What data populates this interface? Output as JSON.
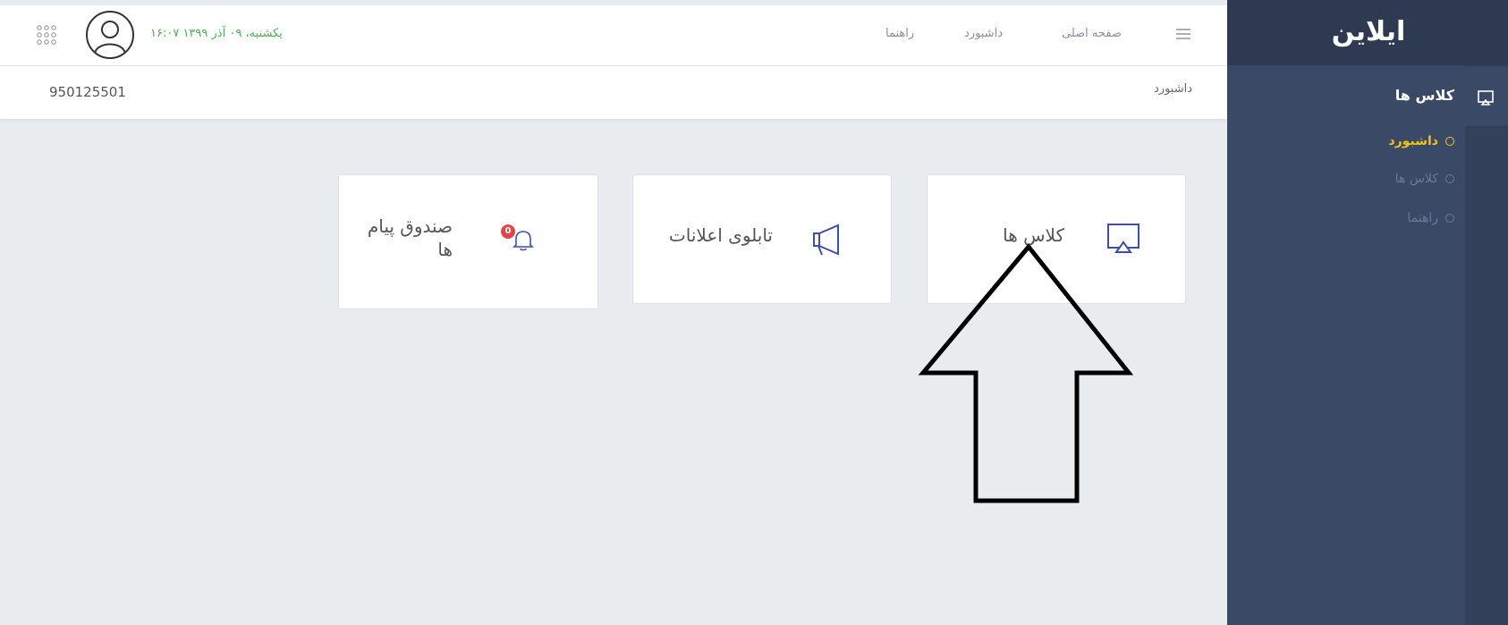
{
  "header": {
    "datetime": "یکشنبه، ۰۹ آذر ۱۳۹۹ ۱۶:۰۷",
    "nav": [
      "صفحه اصلی",
      "داشبورد",
      "راهنما"
    ],
    "icons": [
      "apps-grid-icon",
      "user-avatar",
      "hamburger-menu-icon"
    ]
  },
  "breadcrumb": {
    "current": "داشبورد",
    "user_id": "950125501"
  },
  "sidebar": {
    "logo": "ایلاین",
    "section_title": "کلاس ها",
    "section_icon": "screen-cast-icon",
    "items": [
      {
        "label": "داشبورد",
        "active": true
      },
      {
        "label": "کلاس ها",
        "active": false
      },
      {
        "label": "راهنما",
        "active": false
      }
    ]
  },
  "cards": [
    {
      "label": "کلاس ها",
      "icon": "screen-cast-icon"
    },
    {
      "label": "تابلوی اعلانات",
      "icon": "megaphone-icon"
    },
    {
      "label": "صندوق پیام ها",
      "icon": "bell-icon",
      "badge": "0"
    }
  ],
  "colors": {
    "sidebar": "#3a4965",
    "sidebar_logo_bar": "#2d3a51",
    "active_item": "#f0c419",
    "datetime_text": "#4caf50",
    "icon_accent": "#3f4fa8",
    "badge": "#e04848"
  }
}
